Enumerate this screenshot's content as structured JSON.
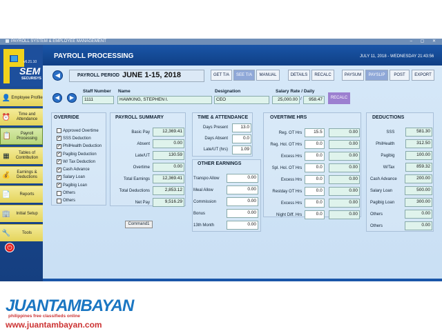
{
  "window": {
    "title": "PAYROLL SYSTEM & EMPLOYEE MANAGEMENT",
    "controls": "– ▢ ✕"
  },
  "logo": {
    "version": "v6.21.10",
    "name": "SEM",
    "tagline": "SECURISYS"
  },
  "sidebar": {
    "items": [
      {
        "label": "Employee Profile",
        "icon": "employee-icon"
      },
      {
        "label": "Time and Attendance",
        "icon": "clock-icon"
      },
      {
        "label": "Payroll Processing",
        "icon": "payroll-icon"
      },
      {
        "label": "Tables of Contribution",
        "icon": "tables-icon"
      },
      {
        "label": "Earnings & Deductions",
        "icon": "earnings-icon"
      },
      {
        "label": "Reports",
        "icon": "reports-icon"
      },
      {
        "label": "Initial Setup",
        "icon": "building-icon"
      },
      {
        "label": "Tools",
        "icon": "tools-icon"
      }
    ]
  },
  "header": {
    "title": "PAYROLL PROCESSING",
    "date": "JULY 11, 2018 - WEDNESDAY 21:43:56"
  },
  "period": {
    "label": "PAYROLL PERIOD",
    "value": "JUNE 1-15, 2018"
  },
  "toolbar": {
    "get_ta": "GET T/A",
    "see_ta": "SEE T/A",
    "manual": "MANUAL",
    "details": "DETAILS",
    "recalc": "RECALC",
    "paysum": "PAYSUM",
    "payslip": "PAYSLIP",
    "post": "POST",
    "export": "EXPORT"
  },
  "employee": {
    "staff_label": "Staff Number",
    "staff_value": "1111",
    "name_label": "Name",
    "name_value": "HAWKING, STEPHEN I.",
    "designation_label": "Designation",
    "designation_value": "CEO",
    "salary_label": "Salary Rate / Daily",
    "salary_value": "25,000.00",
    "slash": "/",
    "daily_value": "958.47",
    "recalc": "RECALC"
  },
  "override": {
    "title": "OVERRIDE",
    "items": [
      {
        "label": "Approved Overtime",
        "checked": false
      },
      {
        "label": "SSS Deduction",
        "checked": true
      },
      {
        "label": "PhilHealth Deduction",
        "checked": true
      },
      {
        "label": "Pagibig Deduction",
        "checked": true
      },
      {
        "label": "W/ Tax Deduction",
        "checked": true
      },
      {
        "label": "Cash Advance",
        "checked": true
      },
      {
        "label": "Salary Loan",
        "checked": true
      },
      {
        "label": "Pagibig Loan",
        "checked": true
      },
      {
        "label": "Others",
        "checked": false
      },
      {
        "label": "Others",
        "checked": false
      }
    ]
  },
  "summary": {
    "title": "PAYROLL SUMMARY",
    "rows": [
      {
        "label": "Basic Pay",
        "value": "12,369.41"
      },
      {
        "label": "Absent",
        "value": "0.00"
      },
      {
        "label": "Late/UT",
        "value": "130.59"
      },
      {
        "label": "Overtime",
        "value": "0.00"
      },
      {
        "label": "Total Earnings",
        "value": "12,369.41"
      },
      {
        "label": "Total Deductions",
        "value": "2,853.12"
      },
      {
        "label": "Net Pay",
        "value": "9,516.29"
      }
    ]
  },
  "command_button": "Command1",
  "time_attendance": {
    "title": "TIME & ATTENDANCE",
    "rows": [
      {
        "label": "Days Present",
        "value": "13.0"
      },
      {
        "label": "Days Absent",
        "value": "0.0"
      },
      {
        "label": "Late/UT (hrs)",
        "value": "1.09"
      }
    ]
  },
  "other_earnings": {
    "title": "OTHER EARNINGS",
    "rows": [
      {
        "label": "Transpo Allow",
        "value": "0.00"
      },
      {
        "label": "Meal Allow",
        "value": "0.00"
      },
      {
        "label": "Commission",
        "value": "0.00"
      },
      {
        "label": "Bonus",
        "value": "0.00"
      },
      {
        "label": "13th Month",
        "value": "0.00"
      }
    ]
  },
  "overtime": {
    "title": "OVERTIME HRS",
    "rows": [
      {
        "label": "Reg. OT Hrs",
        "hrs": "15.5",
        "amount": "0.00"
      },
      {
        "label": "Reg. Hol. OT Hrs",
        "hrs": "0.0",
        "amount": "0.00"
      },
      {
        "label": "Excess Hrs",
        "hrs": "0.0",
        "amount": "0.00"
      },
      {
        "label": "Spl. Hol. OT Hrs",
        "hrs": "0.0",
        "amount": "0.00"
      },
      {
        "label": "Excess Hrs",
        "hrs": "0.0",
        "amount": "0.00"
      },
      {
        "label": "Restday OT Hrs",
        "hrs": "0.0",
        "amount": "0.00"
      },
      {
        "label": "Excess Hrs",
        "hrs": "0.0",
        "amount": "0.00"
      },
      {
        "label": "Night Diff. Hrs",
        "hrs": "0.0",
        "amount": "0.00"
      }
    ]
  },
  "deductions": {
    "title": "DEDUCTIONS",
    "rows": [
      {
        "label": "SSS",
        "value": "581.30"
      },
      {
        "label": "PhilHealth",
        "value": "312.50"
      },
      {
        "label": "Pagibig",
        "value": "100.00"
      },
      {
        "label": "W/Tax",
        "value": "859.32"
      },
      {
        "label": "Cash Advance",
        "value": "200.00"
      },
      {
        "label": "Salary Loan",
        "value": "500.00"
      },
      {
        "label": "Pagibig Loan",
        "value": "300.00"
      },
      {
        "label": "Others",
        "value": "0.00"
      },
      {
        "label": "Others",
        "value": "0.00"
      }
    ]
  },
  "watermark": {
    "brand": "JUANTAMBAYAN",
    "tagline": "philippines free classifieds online",
    "url": "www.juantambayan.com"
  }
}
